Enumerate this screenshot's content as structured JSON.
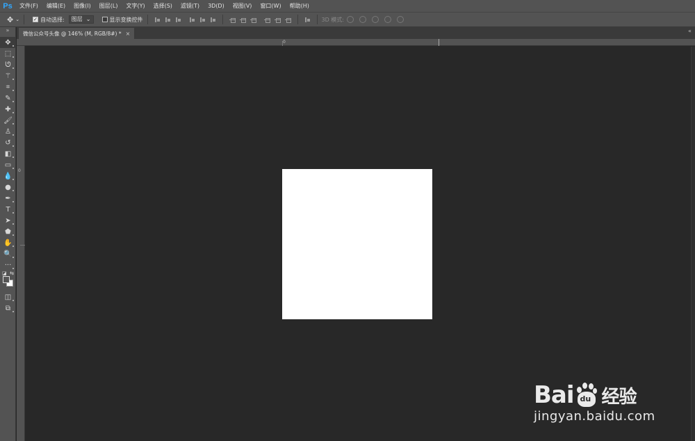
{
  "app": {
    "logo": "Ps"
  },
  "menu": [
    {
      "label": "文件(F)"
    },
    {
      "label": "编辑(E)"
    },
    {
      "label": "图像(I)"
    },
    {
      "label": "图层(L)"
    },
    {
      "label": "文字(Y)"
    },
    {
      "label": "选择(S)"
    },
    {
      "label": "滤镜(T)"
    },
    {
      "label": "3D(D)"
    },
    {
      "label": "视图(V)"
    },
    {
      "label": "窗口(W)"
    },
    {
      "label": "帮助(H)"
    }
  ],
  "options": {
    "auto_select_label": "自动选择:",
    "auto_select_checked": true,
    "auto_select_target": "图层",
    "show_transform_label": "显示变换控件",
    "show_transform_checked": false,
    "mode_3d_label": "3D 模式:"
  },
  "document_tab": {
    "title": "微信公众号头像 @ 146% (M, RGB/8#) *",
    "close": "×"
  },
  "rulers": {
    "h_zero": "0",
    "v_zero": "0"
  },
  "tools": [
    {
      "name": "move-tool",
      "glyph": "✥"
    },
    {
      "name": "marquee-tool",
      "glyph": "⬚"
    },
    {
      "name": "lasso-tool",
      "glyph": "ᘎ"
    },
    {
      "name": "magic-wand-tool",
      "glyph": "⚚"
    },
    {
      "name": "crop-tool",
      "glyph": "⌗"
    },
    {
      "name": "eyedropper-tool",
      "glyph": "✎"
    },
    {
      "name": "healing-brush-tool",
      "glyph": "✚"
    },
    {
      "name": "brush-tool",
      "glyph": "🖌"
    },
    {
      "name": "clone-stamp-tool",
      "glyph": "♙"
    },
    {
      "name": "history-brush-tool",
      "glyph": "↺"
    },
    {
      "name": "eraser-tool",
      "glyph": "◧"
    },
    {
      "name": "gradient-tool",
      "glyph": "▭"
    },
    {
      "name": "blur-tool",
      "glyph": "💧"
    },
    {
      "name": "dodge-tool",
      "glyph": "●"
    },
    {
      "name": "pen-tool",
      "glyph": "✒"
    },
    {
      "name": "type-tool",
      "glyph": "T"
    },
    {
      "name": "path-selection-tool",
      "glyph": "➤"
    },
    {
      "name": "shape-tool",
      "glyph": "⬟"
    },
    {
      "name": "hand-tool",
      "glyph": "✋"
    },
    {
      "name": "zoom-tool",
      "glyph": "🔍"
    },
    {
      "name": "edit-toolbar",
      "glyph": "···"
    }
  ],
  "extra_tools": [
    {
      "name": "quick-mask-button",
      "glyph": "◫"
    },
    {
      "name": "screen-mode-button",
      "glyph": "⧉"
    }
  ],
  "colors": {
    "foreground": "#565656",
    "background": "#ffffff",
    "canvas_bg": "#282828",
    "document": "#ffffff",
    "logo": "#31a8ff"
  },
  "watermark": {
    "bai": "Bai",
    "du": "du",
    "jingyan": "经验",
    "url": "jingyan.baidu.com"
  }
}
